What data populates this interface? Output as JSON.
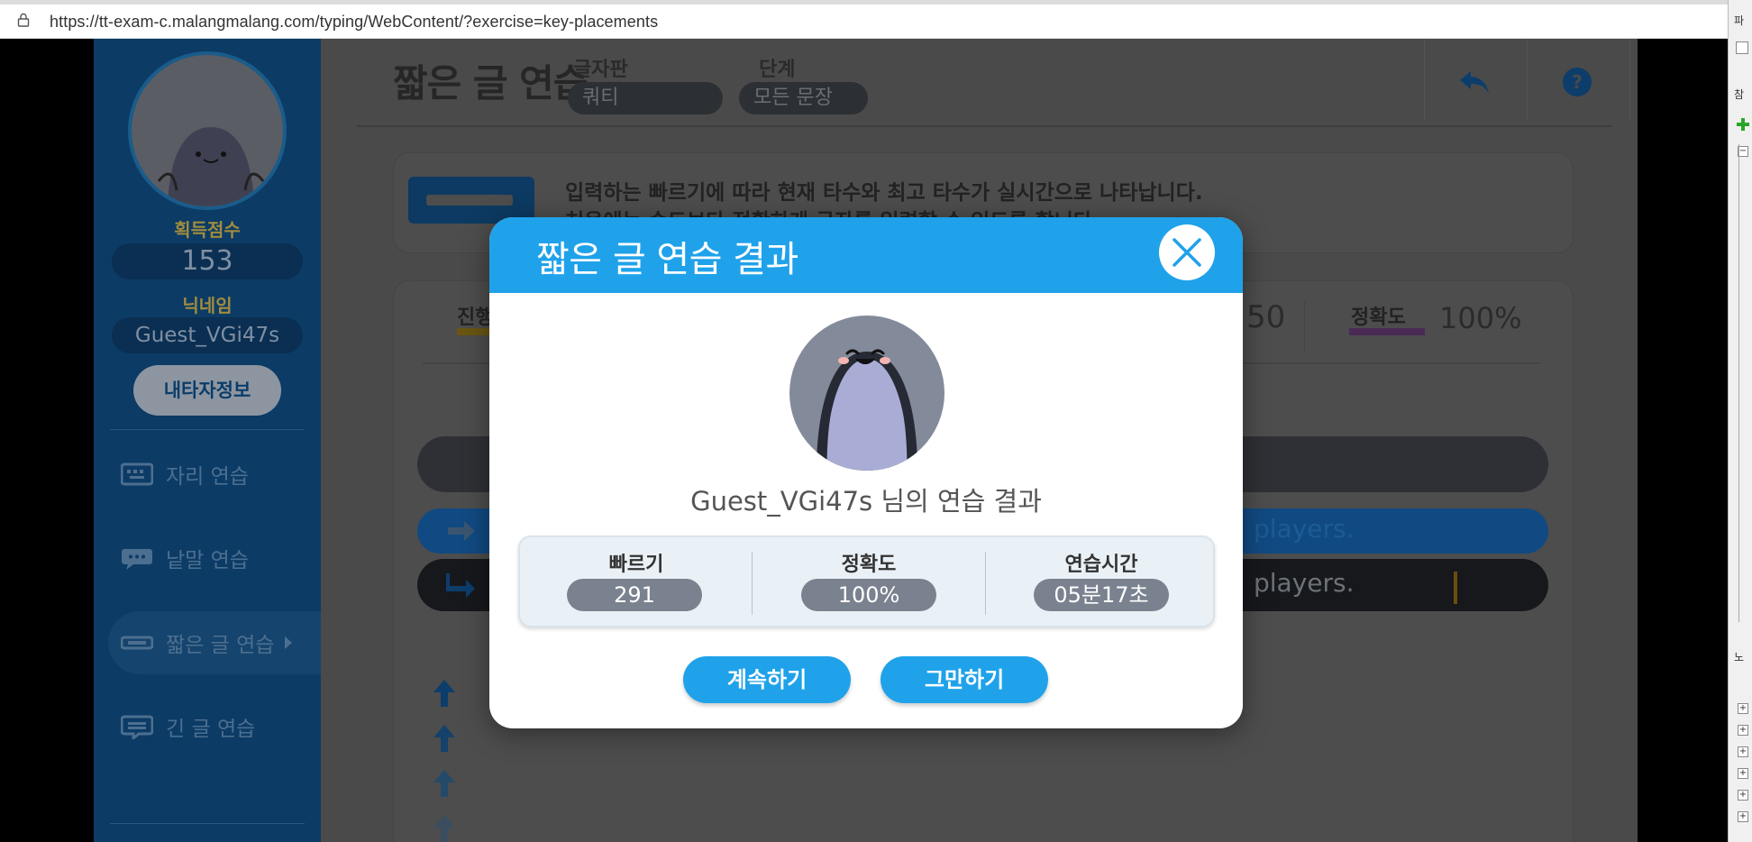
{
  "browser": {
    "url": "https://tt-exam-c.malangmalang.com/typing/WebContent/?exercise=key-placements"
  },
  "sidepanel": {
    "glyph_top": "파",
    "glyph_2": "참",
    "glyph_3": "노"
  },
  "sidebar": {
    "score_label": "획득점수",
    "score_value": "153",
    "nickname_label": "닉네임",
    "nickname_value": "Guest_VGi47s",
    "myinfo_button": "내타자정보",
    "menu": [
      {
        "label": "자리 연습",
        "icon": "keyboard-icon"
      },
      {
        "label": "낱말 연습",
        "icon": "speech-bubble-icon"
      },
      {
        "label": "짧은 글 연습",
        "icon": "short-text-icon"
      },
      {
        "label": "긴 글 연습",
        "icon": "long-text-icon"
      }
    ],
    "active_index": 2
  },
  "header": {
    "title": "짧은 글 연습",
    "keyboard_label": "글자판",
    "keyboard_value": "쿼티",
    "level_label": "단계",
    "level_value": "모든 문장"
  },
  "info": {
    "line1": "입력하는 빠르기에 따라 현재 타수와 최고 타수가 실시간으로 나타납니다.",
    "line2": "처음에는 속도보다 정확하게 글자를 입력할 수 있도록 합니다."
  },
  "stats": {
    "progress_label": "진행",
    "speed_partial": "50",
    "accuracy_label": "정확도",
    "accuracy_value": "100%"
  },
  "practice": {
    "target_tail": "players.",
    "typed_tail": "players."
  },
  "modal": {
    "title": "짧은 글 연습 결과",
    "username_line": "Guest_VGi47s 님의 연습 결과",
    "results": [
      {
        "label": "빠르기",
        "value": "291"
      },
      {
        "label": "정확도",
        "value": "100%"
      },
      {
        "label": "연습시간",
        "value": "05분17초"
      }
    ],
    "continue_button": "계속하기",
    "stop_button": "그만하기"
  },
  "colors": {
    "modal_accent": "#1fa2ea",
    "result_pill": "#7a828f",
    "sidebar_dim": "#0c3b66"
  }
}
